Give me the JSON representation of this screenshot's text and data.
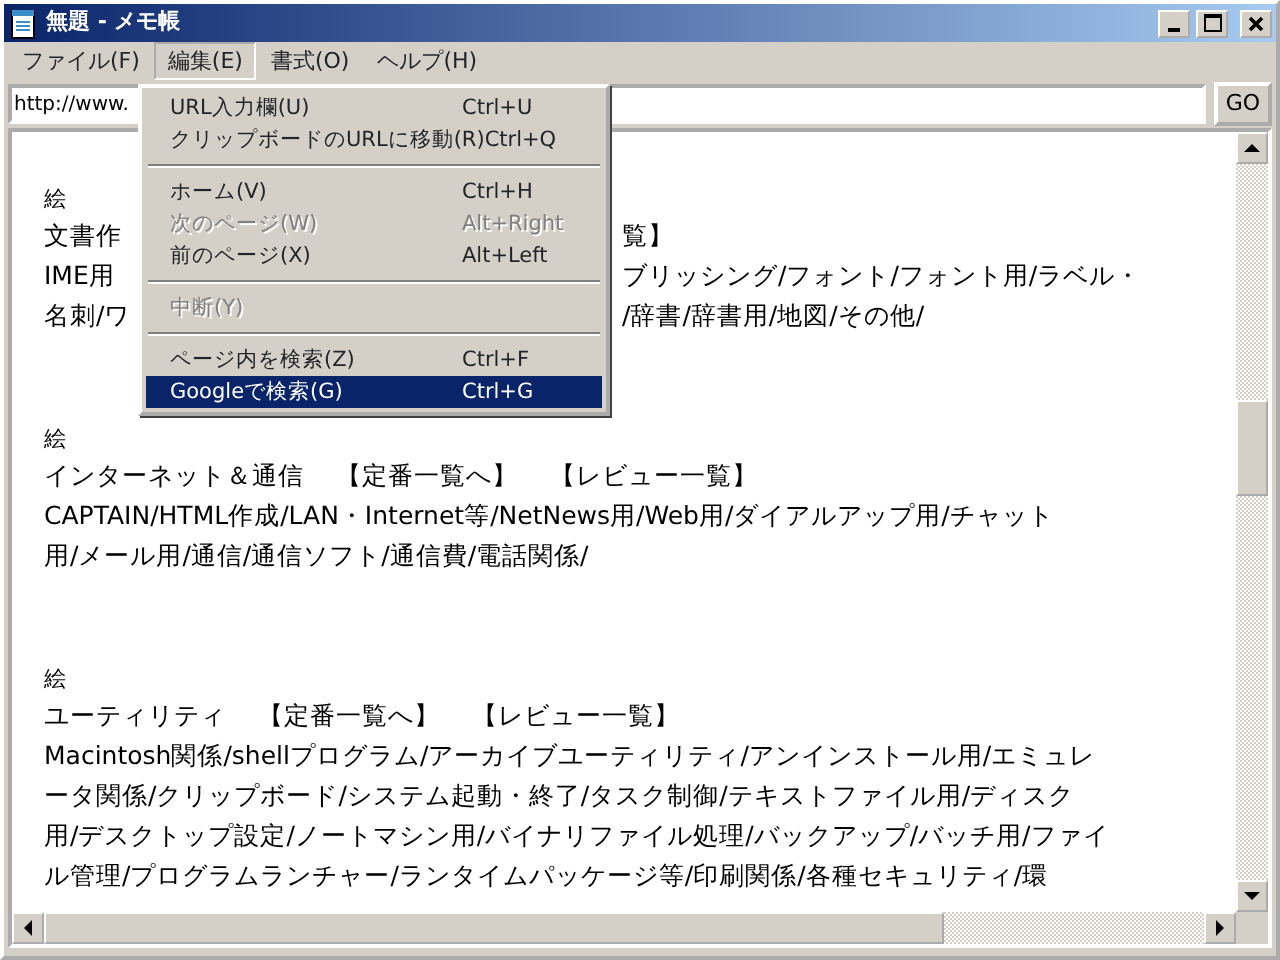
{
  "window": {
    "title": "無題 - メモ帳"
  },
  "menubar": [
    {
      "label": "ファイル(F)",
      "selected": false
    },
    {
      "label": "編集(E)",
      "selected": true
    },
    {
      "label": "書式(O)",
      "selected": false
    },
    {
      "label": "ヘルプ(H)",
      "selected": false
    }
  ],
  "address": {
    "value": "http://www.",
    "button": "GO"
  },
  "menu": [
    {
      "kind": "item",
      "label": "URL入力欄(U)",
      "shortcut": "Ctrl+U",
      "disabled": false,
      "selected": false
    },
    {
      "kind": "item",
      "label": "クリップボードのURLに移動(R)",
      "shortcut": "Ctrl+Q",
      "disabled": false,
      "selected": false
    },
    {
      "kind": "separator"
    },
    {
      "kind": "item",
      "label": "ホーム(V)",
      "shortcut": "Ctrl+H",
      "disabled": false,
      "selected": false
    },
    {
      "kind": "item",
      "label": "次のページ(W)",
      "shortcut": "Alt+Right",
      "disabled": true,
      "selected": false
    },
    {
      "kind": "item",
      "label": "前のページ(X)",
      "shortcut": "Alt+Left",
      "disabled": false,
      "selected": false
    },
    {
      "kind": "separator"
    },
    {
      "kind": "item",
      "label": "中断(Y)",
      "disabled": true,
      "selected": false
    },
    {
      "kind": "separator"
    },
    {
      "kind": "item",
      "label": "ページ内を検索(Z)",
      "shortcut": "Ctrl+F",
      "disabled": false,
      "selected": false
    },
    {
      "kind": "item",
      "label": "Googleで検索(G)",
      "shortcut": "Ctrl+G",
      "disabled": false,
      "selected": true
    }
  ],
  "sections": [
    {
      "picture_label": "絵",
      "title_parts": [
        {
          "left": "文書作",
          "right": "覧】"
        }
      ],
      "lines": [
        {
          "left": "IME用",
          "right": "ブリッシング/フォント/フォント用/ラベル・"
        },
        {
          "left": "名刺/ワ",
          "right": "/辞書/辞書用/地図/その他/"
        }
      ]
    },
    {
      "picture_label": "絵",
      "title": "インターネット＆通信",
      "links": [
        "【定番一覧へ】",
        "【レビュー一覧】"
      ],
      "lines": [
        {
          "left": "CAPTAIN/HTML作成/LAN・Internet等/NetNews用/Web用/ダイアルアップ用/チャット"
        },
        {
          "left": "用/メール用/通信/通信ソフト/通信費/電話関係/"
        }
      ]
    },
    {
      "picture_label": "絵",
      "title": "ユーティリティ",
      "links": [
        "【定番一覧へ】",
        "【レビュー一覧】"
      ],
      "lines": [
        {
          "left": "Macintosh関係/shellプログラム/アーカイブユーティリティ/アンインストール用/エミュレ"
        },
        {
          "left": "ータ関係/クリップボード/システム起動・終了/タスク制御/テキストファイル用/ディスク"
        },
        {
          "left": "用/デスクトップ設定/ノートマシン用/バイナリファイル処理/バックアップ/バッチ用/ファイ"
        },
        {
          "left": "ル管理/プログラムランチャー/ランタイムパッケージ等/印刷関係/各種セキュリティ/環"
        }
      ]
    }
  ]
}
